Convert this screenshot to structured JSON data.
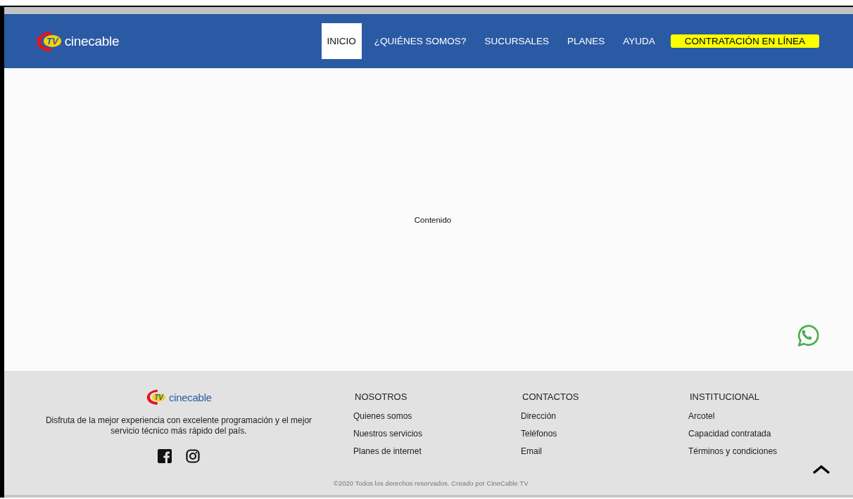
{
  "header": {
    "logo": {
      "badge": "TV",
      "wordmark": "cinecable"
    },
    "nav": [
      {
        "label": "INICIO",
        "kind": "link",
        "selected": true
      },
      {
        "label": "¿QUIÉNES SOMOS?",
        "kind": "link",
        "selected": false
      },
      {
        "label": "SUCURSALES",
        "kind": "link",
        "selected": false
      },
      {
        "label": "PLANES",
        "kind": "link",
        "selected": false
      },
      {
        "label": "AYUDA",
        "kind": "link",
        "selected": false
      },
      {
        "label": "CONTRATACIÓN EN LÍNEA",
        "kind": "cta",
        "selected": false
      }
    ]
  },
  "main": {
    "placeholder_text": "Contenido"
  },
  "footer": {
    "logo": {
      "badge": "TV",
      "wordmark": "cinecable"
    },
    "tagline": "Disfruta de la mejor experiencia con excelente programación y el mejor servicio técnico más rápido del país.",
    "columns": [
      {
        "heading": "NOSOTROS",
        "links": [
          "Quienes somos",
          "Nuestros servicios",
          "Planes de internet"
        ]
      },
      {
        "heading": "CONTACTOS",
        "links": [
          "Dirección",
          "Teléfonos",
          "Email"
        ]
      },
      {
        "heading": "INSTITUCIONAL",
        "links": [
          "Arcotel",
          "Capacidad contratada",
          "Términos y condiciones"
        ]
      }
    ],
    "copyright": "©2020 Todos los derechos reservados. Creado por CineCable TV"
  }
}
